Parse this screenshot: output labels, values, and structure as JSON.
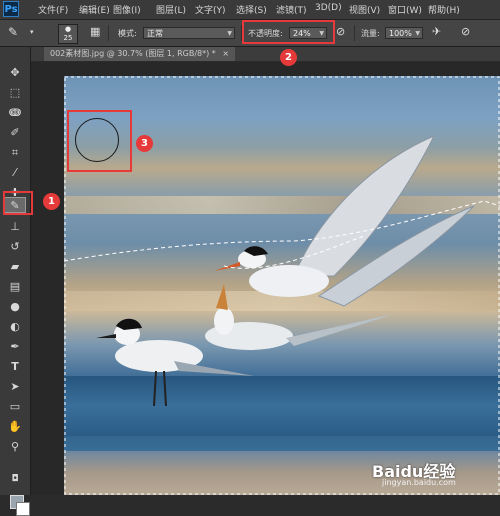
{
  "app": {
    "logo": "Ps"
  },
  "menu": [
    "文件(F)",
    "编辑(E)",
    "图像(I)",
    "图层(L)",
    "文字(Y)",
    "选择(S)",
    "滤镜(T)",
    "3D(D)",
    "视图(V)",
    "窗口(W)",
    "帮助(H)"
  ],
  "options": {
    "brush_size": "25",
    "mode_label": "模式:",
    "mode_value": "正常",
    "opacity_label": "不透明度:",
    "opacity_value": "24%",
    "flow_label": "流量:",
    "flow_value": "100%"
  },
  "document": {
    "tab_title": "002素材图.jpg @ 30.7% (图层 1, RGB/8*) *",
    "close": "×"
  },
  "callouts": [
    "1",
    "2",
    "3"
  ],
  "watermark": {
    "brand": "Baidu经验",
    "url": "jingyan.baidu.com"
  },
  "colors": {
    "callout": "#e63a3a",
    "foreground": "#9aa5b0",
    "background": "#ffffff"
  }
}
